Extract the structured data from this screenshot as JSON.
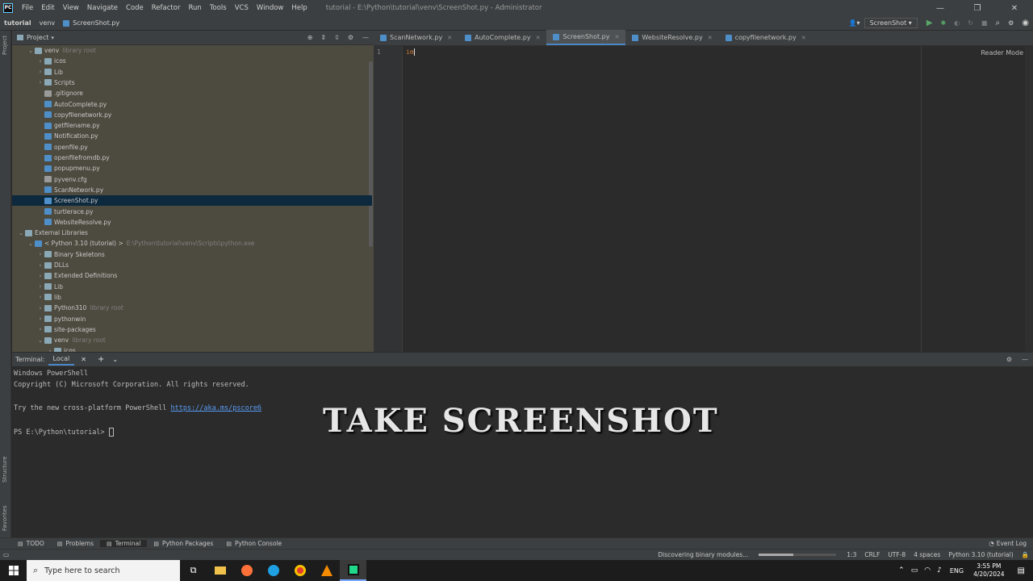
{
  "titlebar": {
    "menus": [
      "File",
      "Edit",
      "View",
      "Navigate",
      "Code",
      "Refactor",
      "Run",
      "Tools",
      "VCS",
      "Window",
      "Help"
    ],
    "window_title": "tutorial - E:\\Python\\tutorial\\venv\\ScreenShot.py - Administrator"
  },
  "navbar": {
    "crumbs": [
      "tutorial",
      "venv",
      "ScreenShot.py"
    ],
    "run_config": "ScreenShot"
  },
  "project": {
    "title": "Project",
    "rows": [
      {
        "label": "venv",
        "hint": "library root",
        "type": "folder",
        "indent": 1,
        "open": true
      },
      {
        "label": "icos",
        "type": "folder",
        "indent": 2,
        "open": false
      },
      {
        "label": "Lib",
        "type": "folder",
        "indent": 2,
        "open": false
      },
      {
        "label": "Scripts",
        "type": "folder",
        "indent": 2,
        "open": false
      },
      {
        "label": ".gitignore",
        "type": "cfg",
        "indent": 2
      },
      {
        "label": "AutoComplete.py",
        "type": "py",
        "indent": 2
      },
      {
        "label": "copyfilenetwork.py",
        "type": "py",
        "indent": 2
      },
      {
        "label": "getfilename.py",
        "type": "py",
        "indent": 2
      },
      {
        "label": "Notification.py",
        "type": "py",
        "indent": 2
      },
      {
        "label": "openfile.py",
        "type": "py",
        "indent": 2
      },
      {
        "label": "openfilefromdb.py",
        "type": "py",
        "indent": 2
      },
      {
        "label": "popupmenu.py",
        "type": "py",
        "indent": 2
      },
      {
        "label": "pyvenv.cfg",
        "type": "cfg",
        "indent": 2
      },
      {
        "label": "ScanNetwork.py",
        "type": "py",
        "indent": 2
      },
      {
        "label": "ScreenShot.py",
        "type": "py",
        "indent": 2,
        "selected": true
      },
      {
        "label": "turtlerace.py",
        "type": "py",
        "indent": 2
      },
      {
        "label": "WebsiteResolve.py",
        "type": "py",
        "indent": 2
      },
      {
        "label": "External Libraries",
        "type": "folder",
        "indent": 0,
        "open": true
      },
      {
        "label": "< Python 3.10 (tutorial) >",
        "hint": "E:\\Python\\tutorial\\venv\\Scripts\\python.exe",
        "type": "py",
        "indent": 1,
        "open": true
      },
      {
        "label": "Binary Skeletons",
        "type": "folder",
        "indent": 2,
        "open": false
      },
      {
        "label": "DLLs",
        "type": "folder",
        "indent": 2,
        "open": false
      },
      {
        "label": "Extended Definitions",
        "type": "folder",
        "indent": 2,
        "open": false
      },
      {
        "label": "Lib",
        "type": "folder",
        "indent": 2,
        "open": false
      },
      {
        "label": "lib",
        "type": "folder",
        "indent": 2,
        "open": false
      },
      {
        "label": "Python310",
        "hint": "library root",
        "type": "folder",
        "indent": 2,
        "open": false
      },
      {
        "label": "pythonwin",
        "type": "folder",
        "indent": 2,
        "open": false
      },
      {
        "label": "site-packages",
        "type": "folder",
        "indent": 2,
        "open": false
      },
      {
        "label": "venv",
        "hint": "library root",
        "type": "folder",
        "indent": 2,
        "open": true
      },
      {
        "label": "icos",
        "type": "folder",
        "indent": 3,
        "open": false
      }
    ]
  },
  "editor": {
    "tabs": [
      "ScanNetwork.py",
      "AutoComplete.py",
      "ScreenShot.py",
      "WebsiteResolve.py",
      "copyfilenetwork.py"
    ],
    "active_tab": 2,
    "line_number": "1",
    "code": "im",
    "reader_mode": "Reader Mode"
  },
  "terminal": {
    "label": "Terminal:",
    "tab": "Local",
    "lines": [
      "Windows PowerShell",
      "Copyright (C) Microsoft Corporation. All rights reserved.",
      "",
      "Try the new cross-platform PowerShell ",
      "",
      "PS E:\\Python\\tutorial> "
    ],
    "link": "https://aka.ms/pscore6"
  },
  "overlay_text": "TAKE SCREENSHOT",
  "tool_windows": [
    "TODO",
    "Problems",
    "Terminal",
    "Python Packages",
    "Python Console"
  ],
  "event_log": "Event Log",
  "status": {
    "message": "Discovering binary modules...",
    "position": "1:3",
    "line_sep": "CRLF",
    "encoding": "UTF-8",
    "indent": "4 spaces",
    "interpreter": "Python 3.10 (tutorial)"
  },
  "side_labels": {
    "project": "Project",
    "structure": "Structure",
    "favorites": "Favorites"
  },
  "taskbar": {
    "search_placeholder": "Type here to search",
    "lang": "ENG",
    "time": "3:55 PM",
    "date": "4/20/2024"
  }
}
